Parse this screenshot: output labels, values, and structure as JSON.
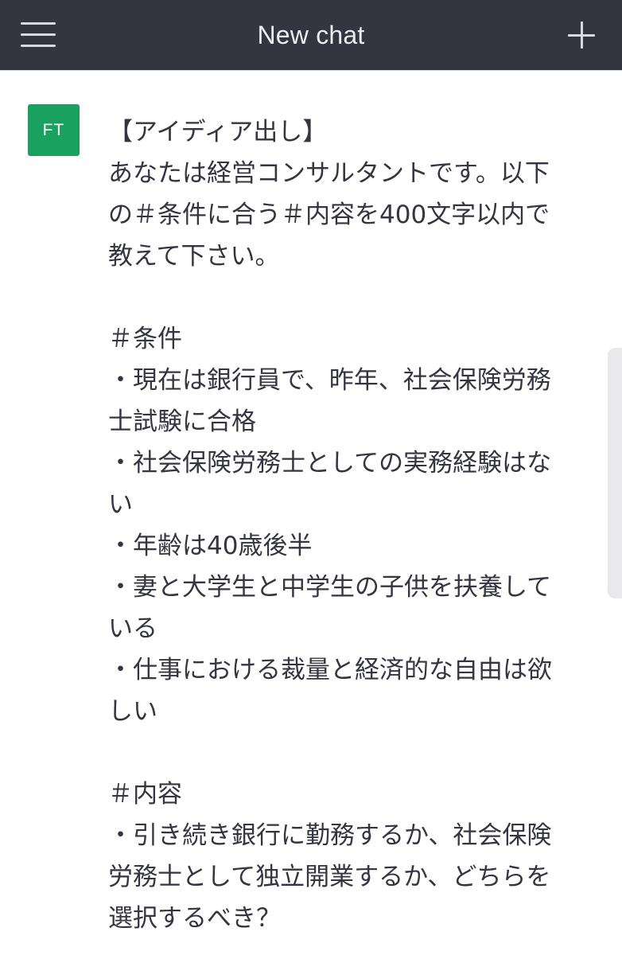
{
  "header": {
    "title": "New chat",
    "menu_icon": "hamburger-menu-icon",
    "new_chat_icon": "plus-icon"
  },
  "message": {
    "avatar_initials": "FT",
    "avatar_color": "#19a15f",
    "text": "【アイディア出し】\nあなたは経営コンサルタントです。以下の＃条件に合う＃内容を400文字以内で教えて下さい。\n\n＃条件\n・現在は銀行員で、昨年、社会保険労務士試験に合格\n・社会保険労務士としての実務経験はない\n・年齢は40歳後半\n・妻と大学生と中学生の子供を扶養している\n・仕事における裁量と経済的な自由は欲しい\n\n＃内容\n・引き続き銀行に勤務するか、社会保険労務士として独立開業するか、どちらを選択するべき？"
  },
  "colors": {
    "header_background": "#343541",
    "text": "#343541",
    "background": "#ffffff"
  }
}
